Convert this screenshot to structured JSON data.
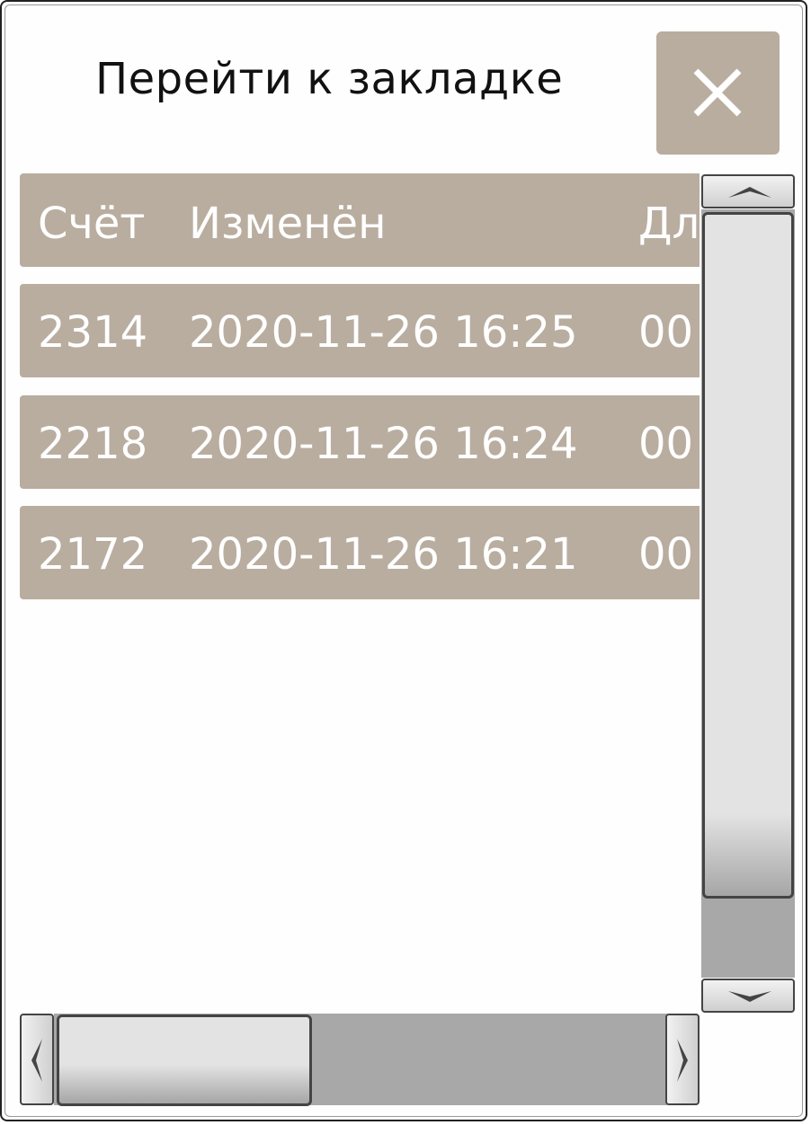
{
  "dialog": {
    "title": "Перейти к закладке",
    "close_icon": "close-icon"
  },
  "table": {
    "columns": [
      "Счёт",
      "Изменён",
      "Дл"
    ],
    "rows": [
      [
        "2314",
        "2020-11-26 16:25",
        "00"
      ],
      [
        "2218",
        "2020-11-26 16:24",
        "00"
      ],
      [
        "2172",
        "2020-11-26 16:21",
        "00"
      ]
    ]
  },
  "scrollbars": {
    "vertical": {
      "up_icon": "chevron-up-icon",
      "down_icon": "chevron-down-icon"
    },
    "horizontal": {
      "left_icon": "chevron-left-icon",
      "right_icon": "chevron-right-icon"
    }
  },
  "colors": {
    "accent": "#b9ada0",
    "row_text": "#ffffff",
    "scroll_track": "#a8a8a8"
  }
}
